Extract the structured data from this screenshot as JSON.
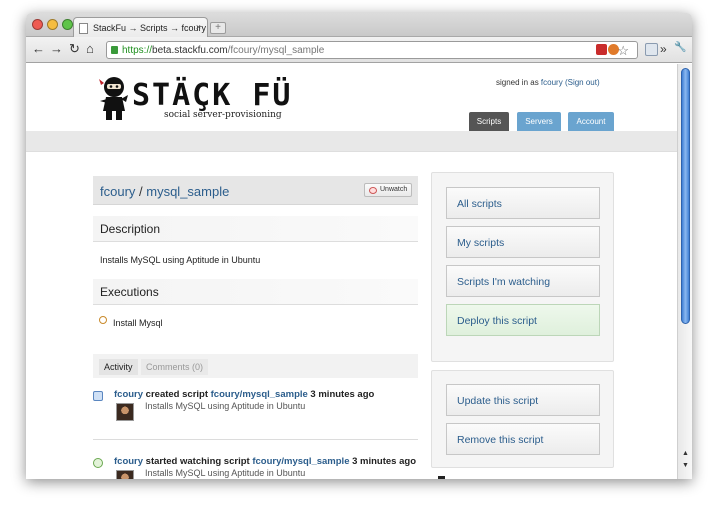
{
  "browser": {
    "tab_title": "StackFu → Scripts → fcoury",
    "tab_close": "×",
    "new_tab": "+",
    "url_scheme": "https://",
    "url_host": "beta.stackfu.com",
    "url_path": "/fcoury/mysql_sample",
    "back": "←",
    "forward": "→",
    "reload": "↻",
    "home": "⌂",
    "star": "☆",
    "menu_page": "»",
    "wrench": "🔧",
    "colors": {
      "lock": "#3a9a3a",
      "https": "#1f8f1f"
    }
  },
  "site": {
    "logo_text": "STÄÇK FÜ",
    "tagline": "social server-provisioning",
    "signed_in_prefix": "signed in as ",
    "user": "fcoury",
    "sign_out": "(Sign out)",
    "nav": [
      {
        "label": "Scripts",
        "active": true,
        "color": "#555555"
      },
      {
        "label": "Servers",
        "active": false,
        "color": "#6aa4cf"
      },
      {
        "label": "Account",
        "active": false,
        "color": "#6aa4cf"
      }
    ]
  },
  "script": {
    "owner": "fcoury",
    "separator": " / ",
    "name": "mysql_sample",
    "unwatch_label": "Unwatch",
    "description_heading": "Description",
    "description": "Installs MySQL using Aptitude in Ubuntu",
    "executions_heading": "Executions",
    "executions": [
      "Install Mysql"
    ]
  },
  "activity": {
    "tabs": [
      {
        "label": "Activity",
        "active": true
      },
      {
        "label": "Comments (0)",
        "active": false
      }
    ],
    "items": [
      {
        "user": "fcoury",
        "action": " created script ",
        "target": "fcoury/mysql_sample",
        "time": " 3 minutes ago",
        "detail": "Installs MySQL using Aptitude in Ubuntu",
        "icon": "script-icon"
      },
      {
        "user": "fcoury",
        "action": " started watching script ",
        "target": "fcoury/mysql_sample",
        "time": " 3 minutes ago",
        "detail": "Installs MySQL using Aptitude in Ubuntu",
        "icon": "watch-icon"
      }
    ]
  },
  "sidebar": {
    "group1": [
      "All scripts",
      "My scripts",
      "Scripts I'm watching",
      "Deploy this script"
    ],
    "group2": [
      "Update this script",
      "Remove this script"
    ]
  }
}
